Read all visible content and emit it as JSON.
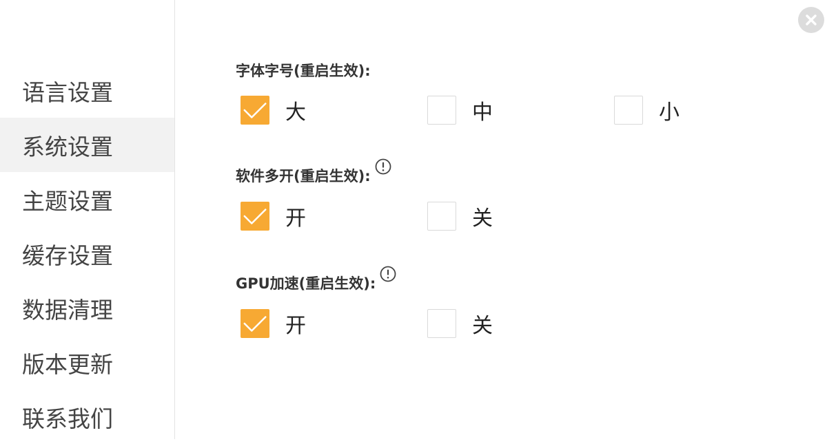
{
  "sidebar": {
    "items": [
      {
        "label": "语言设置"
      },
      {
        "label": "系统设置",
        "active": true
      },
      {
        "label": "主题设置"
      },
      {
        "label": "缓存设置"
      },
      {
        "label": "数据清理"
      },
      {
        "label": "版本更新"
      },
      {
        "label": "联系我们"
      }
    ]
  },
  "close_icon": "close-icon",
  "colors": {
    "accent": "#f7a933",
    "sidebar_active_bg": "#f2f2f2",
    "close_bg": "#dcdcdc"
  },
  "sections": {
    "font_size": {
      "title": "字体字号(重启生效):",
      "options": [
        {
          "label": "大",
          "checked": true
        },
        {
          "label": "中",
          "checked": false
        },
        {
          "label": "小",
          "checked": false
        }
      ]
    },
    "multi_open": {
      "title": "软件多开(重启生效):",
      "info_icon": "info-icon",
      "options": [
        {
          "label": "开",
          "checked": true
        },
        {
          "label": "关",
          "checked": false
        }
      ]
    },
    "gpu": {
      "title": "GPU加速(重启生效):",
      "info_icon": "info-icon",
      "options": [
        {
          "label": "开",
          "checked": true
        },
        {
          "label": "关",
          "checked": false
        }
      ]
    }
  }
}
